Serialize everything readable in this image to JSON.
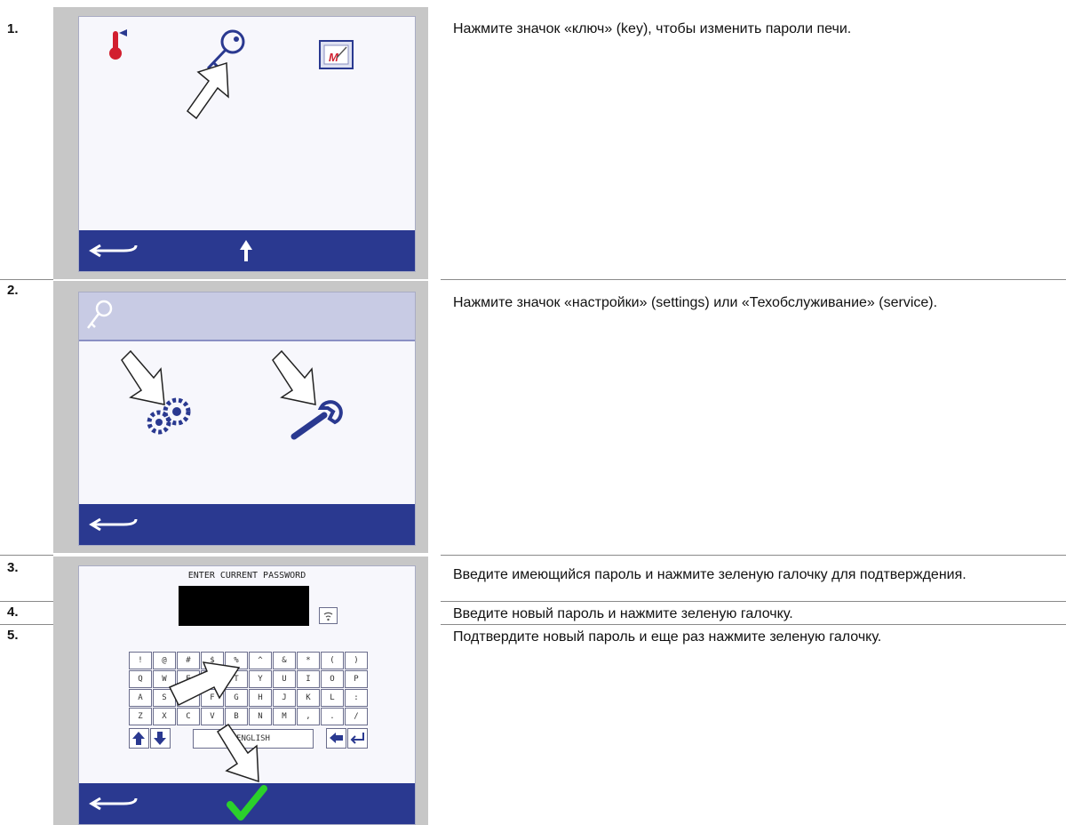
{
  "steps": [
    {
      "number": "1.",
      "text": "Нажмите значок «ключ» (key), чтобы изменить пароли печи."
    },
    {
      "number": "2.",
      "text": "Нажмите значок «настройки» (settings) или «Техобслуживание» (service)."
    },
    {
      "number": "3.",
      "text": "Введите имеющийся пароль и нажмите зеленую галочку для подтверждения."
    },
    {
      "number": "4.",
      "text": "Введите новый пароль и нажмите зеленую галочку."
    },
    {
      "number": "5.",
      "text": "Подтвердите новый пароль и еще раз нажмите зеленую галочку."
    }
  ],
  "password_screen": {
    "title": "ENTER CURRENT PASSWORD",
    "keyboard_rows": [
      [
        "!",
        "@",
        "#",
        "$",
        "%",
        "^",
        "&",
        "*",
        "(",
        ")"
      ],
      [
        "Q",
        "W",
        "E",
        "R",
        "T",
        "Y",
        "U",
        "I",
        "O",
        "P"
      ],
      [
        "A",
        "S",
        "D",
        "F",
        "G",
        "H",
        "J",
        "K",
        "L",
        ":"
      ],
      [
        "Z",
        "X",
        "C",
        "V",
        "B",
        "N",
        "M",
        ",",
        ".",
        "/"
      ]
    ],
    "language_key": "ENGLISH"
  },
  "icons": {
    "screen1": [
      "thermometer-icon",
      "key-icon",
      "oven-image-icon",
      "back-arrow-icon",
      "up-arrow-icon"
    ],
    "screen2": [
      "key-icon",
      "settings-gears-icon",
      "service-wrench-icon",
      "back-arrow-icon"
    ],
    "screen3": [
      "wifi-icon",
      "shift-up-icon",
      "shift-down-icon",
      "backspace-icon",
      "enter-icon",
      "back-arrow-icon",
      "green-check-icon"
    ]
  },
  "colors": {
    "bar": "#2a3990",
    "check": "#2bd12b",
    "thermometer": "#d21f2f"
  }
}
